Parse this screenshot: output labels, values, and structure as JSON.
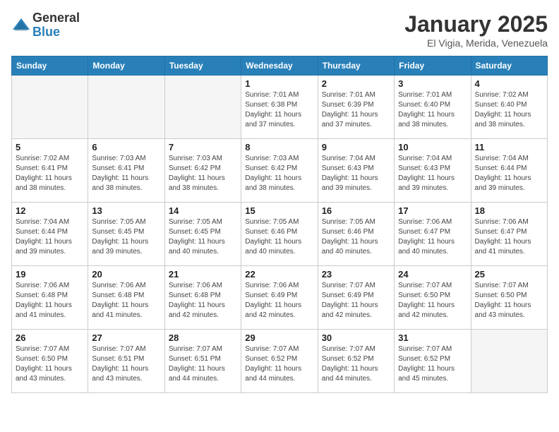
{
  "header": {
    "logo_general": "General",
    "logo_blue": "Blue",
    "month_title": "January 2025",
    "location": "El Vigia, Merida, Venezuela"
  },
  "weekdays": [
    "Sunday",
    "Monday",
    "Tuesday",
    "Wednesday",
    "Thursday",
    "Friday",
    "Saturday"
  ],
  "weeks": [
    [
      {
        "num": "",
        "info": ""
      },
      {
        "num": "",
        "info": ""
      },
      {
        "num": "",
        "info": ""
      },
      {
        "num": "1",
        "info": "Sunrise: 7:01 AM\nSunset: 6:38 PM\nDaylight: 11 hours\nand 37 minutes."
      },
      {
        "num": "2",
        "info": "Sunrise: 7:01 AM\nSunset: 6:39 PM\nDaylight: 11 hours\nand 37 minutes."
      },
      {
        "num": "3",
        "info": "Sunrise: 7:01 AM\nSunset: 6:40 PM\nDaylight: 11 hours\nand 38 minutes."
      },
      {
        "num": "4",
        "info": "Sunrise: 7:02 AM\nSunset: 6:40 PM\nDaylight: 11 hours\nand 38 minutes."
      }
    ],
    [
      {
        "num": "5",
        "info": "Sunrise: 7:02 AM\nSunset: 6:41 PM\nDaylight: 11 hours\nand 38 minutes."
      },
      {
        "num": "6",
        "info": "Sunrise: 7:03 AM\nSunset: 6:41 PM\nDaylight: 11 hours\nand 38 minutes."
      },
      {
        "num": "7",
        "info": "Sunrise: 7:03 AM\nSunset: 6:42 PM\nDaylight: 11 hours\nand 38 minutes."
      },
      {
        "num": "8",
        "info": "Sunrise: 7:03 AM\nSunset: 6:42 PM\nDaylight: 11 hours\nand 38 minutes."
      },
      {
        "num": "9",
        "info": "Sunrise: 7:04 AM\nSunset: 6:43 PM\nDaylight: 11 hours\nand 39 minutes."
      },
      {
        "num": "10",
        "info": "Sunrise: 7:04 AM\nSunset: 6:43 PM\nDaylight: 11 hours\nand 39 minutes."
      },
      {
        "num": "11",
        "info": "Sunrise: 7:04 AM\nSunset: 6:44 PM\nDaylight: 11 hours\nand 39 minutes."
      }
    ],
    [
      {
        "num": "12",
        "info": "Sunrise: 7:04 AM\nSunset: 6:44 PM\nDaylight: 11 hours\nand 39 minutes."
      },
      {
        "num": "13",
        "info": "Sunrise: 7:05 AM\nSunset: 6:45 PM\nDaylight: 11 hours\nand 39 minutes."
      },
      {
        "num": "14",
        "info": "Sunrise: 7:05 AM\nSunset: 6:45 PM\nDaylight: 11 hours\nand 40 minutes."
      },
      {
        "num": "15",
        "info": "Sunrise: 7:05 AM\nSunset: 6:46 PM\nDaylight: 11 hours\nand 40 minutes."
      },
      {
        "num": "16",
        "info": "Sunrise: 7:05 AM\nSunset: 6:46 PM\nDaylight: 11 hours\nand 40 minutes."
      },
      {
        "num": "17",
        "info": "Sunrise: 7:06 AM\nSunset: 6:47 PM\nDaylight: 11 hours\nand 40 minutes."
      },
      {
        "num": "18",
        "info": "Sunrise: 7:06 AM\nSunset: 6:47 PM\nDaylight: 11 hours\nand 41 minutes."
      }
    ],
    [
      {
        "num": "19",
        "info": "Sunrise: 7:06 AM\nSunset: 6:48 PM\nDaylight: 11 hours\nand 41 minutes."
      },
      {
        "num": "20",
        "info": "Sunrise: 7:06 AM\nSunset: 6:48 PM\nDaylight: 11 hours\nand 41 minutes."
      },
      {
        "num": "21",
        "info": "Sunrise: 7:06 AM\nSunset: 6:48 PM\nDaylight: 11 hours\nand 42 minutes."
      },
      {
        "num": "22",
        "info": "Sunrise: 7:06 AM\nSunset: 6:49 PM\nDaylight: 11 hours\nand 42 minutes."
      },
      {
        "num": "23",
        "info": "Sunrise: 7:07 AM\nSunset: 6:49 PM\nDaylight: 11 hours\nand 42 minutes."
      },
      {
        "num": "24",
        "info": "Sunrise: 7:07 AM\nSunset: 6:50 PM\nDaylight: 11 hours\nand 42 minutes."
      },
      {
        "num": "25",
        "info": "Sunrise: 7:07 AM\nSunset: 6:50 PM\nDaylight: 11 hours\nand 43 minutes."
      }
    ],
    [
      {
        "num": "26",
        "info": "Sunrise: 7:07 AM\nSunset: 6:50 PM\nDaylight: 11 hours\nand 43 minutes."
      },
      {
        "num": "27",
        "info": "Sunrise: 7:07 AM\nSunset: 6:51 PM\nDaylight: 11 hours\nand 43 minutes."
      },
      {
        "num": "28",
        "info": "Sunrise: 7:07 AM\nSunset: 6:51 PM\nDaylight: 11 hours\nand 44 minutes."
      },
      {
        "num": "29",
        "info": "Sunrise: 7:07 AM\nSunset: 6:52 PM\nDaylight: 11 hours\nand 44 minutes."
      },
      {
        "num": "30",
        "info": "Sunrise: 7:07 AM\nSunset: 6:52 PM\nDaylight: 11 hours\nand 44 minutes."
      },
      {
        "num": "31",
        "info": "Sunrise: 7:07 AM\nSunset: 6:52 PM\nDaylight: 11 hours\nand 45 minutes."
      },
      {
        "num": "",
        "info": ""
      }
    ]
  ]
}
